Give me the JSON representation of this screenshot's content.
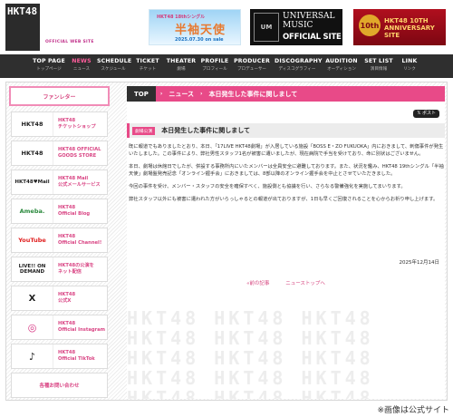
{
  "brand": {
    "logo": "HKT48",
    "site_label": "OFFICIAL WEB SITE"
  },
  "banners": [
    {
      "sub": "HKT48 18thシングル",
      "title": "半袖天使",
      "date": "2025.07.30 on sale"
    },
    {
      "mark": "UM",
      "title": "UNIVERSAL MUSIC",
      "sub": "OFFICIAL SITE"
    },
    {
      "badge": "10th",
      "title": "HKT48 10TH ANNIVERSARY SITE"
    }
  ],
  "nav": [
    {
      "en": "TOP PAGE",
      "ja": "トップページ"
    },
    {
      "en": "NEWS",
      "ja": "ニュース"
    },
    {
      "en": "SCHEDULE",
      "ja": "スケジュール"
    },
    {
      "en": "TICKET",
      "ja": "チケット"
    },
    {
      "en": "THEATER",
      "ja": "劇場"
    },
    {
      "en": "PROFILE",
      "ja": "プロフィール"
    },
    {
      "en": "PRODUCER",
      "ja": "プロデューサー"
    },
    {
      "en": "DISCOGRAPHY",
      "ja": "ディスコグラフィー"
    },
    {
      "en": "AUDITION",
      "ja": "オーディション"
    },
    {
      "en": "SET LIST",
      "ja": "演目情報"
    },
    {
      "en": "LINK",
      "ja": "リンク"
    }
  ],
  "sidebar": {
    "header": "ファンレター",
    "items": [
      {
        "logo": "HKT48",
        "text": "HKT48\nチケットショップ"
      },
      {
        "logo": "HKT48",
        "text": "HKT48 OFFICIAL\nGOODS STORE"
      },
      {
        "logo": "HKT48♥Mail",
        "text": "HKT48 Mail\n公式メールサービス"
      },
      {
        "logo": "Ameba.",
        "text": "HKT48\nOfficial Blog"
      },
      {
        "logo": "YouTube",
        "text": "HKT48\nOfficial Channel!"
      },
      {
        "logo": "LIVE!! ON DEMAND",
        "text": "HKT48の公演を\nネット配信"
      },
      {
        "logo": "X",
        "text": "HKT48\n公式X"
      },
      {
        "logo": "◎",
        "text": "HKT48\nOfficial Instagram"
      },
      {
        "logo": "♪",
        "text": "HKT48\nOfficial TikTok"
      }
    ],
    "footer": "各種お問い合わせ"
  },
  "content": {
    "crumb_home": "TOP",
    "crumb_cat": "ニュース",
    "crumb_page": "本日発生した事件に関しまして",
    "x_button": "𝕏 ポスト",
    "tag": "劇場公演",
    "title": "本日発生した事件に関しまして",
    "paragraphs": [
      "既に報道でもありましたとおり、本日、「17LIVE HKT48劇場」が入居している施設「BOSS E・ZO FUKUOKA」内におきまして、刺傷事件が発生いたしました。この事件により、弊社男性スタッフ1名が被害に遭いましたが、現在病院で手当を受けており、命に別状はございません。",
      "本日、劇場は休館日でしたが、併設する事務所内にいたメンバーは全員安全に避難しております。また、状況を鑑み、HKT48 19thシングル「半袖天使」劇場盤発売記念「オンライン握手会」におきましては、8部以降のオンライン握手会を中止とさせていただきました。",
      "今回の事件を受け、メンバー・スタッフの安全を確保すべく、施設側とも協議を行い、さらなる警備強化を実施してまいります。",
      "弊社スタッフ以外にも被害に遭われた方がいらっしゃるとの報道が出ておりますが、1日も早くご回復されることを心からお祈り申し上げます。"
    ],
    "date": "2025年12月14日",
    "prev": "«前の記事",
    "top": "ニューストップへ"
  },
  "watermark": "HKT48 HKT48 HKT48 HKT48 HKT48 HKT48 HKT48 HKT48 HKT48 HKT48 HKT48 HKT48 HKT48 HKT48 HKT48 HKT48 HKT48 HKT48 HKT48 HKT48",
  "credit": "※画像は公式サイト"
}
